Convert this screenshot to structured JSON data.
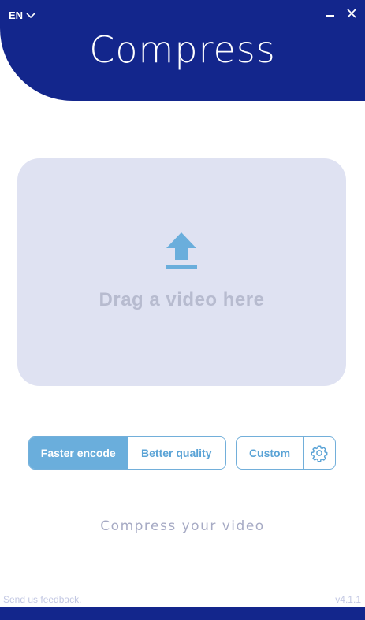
{
  "header": {
    "language": "EN",
    "title": "Compress",
    "background_color": "#13268c"
  },
  "window_controls": {
    "minimize_icon": "minimize-icon",
    "close_icon": "close-icon"
  },
  "dropzone": {
    "text": "Drag a video here",
    "icon": "upload-arrow-icon"
  },
  "modes": {
    "faster": "Faster encode",
    "better": "Better quality",
    "selected": "Faster encode",
    "custom": "Custom",
    "settings_icon": "gear-icon"
  },
  "action": {
    "label": "Compress your video"
  },
  "footer": {
    "feedback": "Send us feedback.",
    "version": "v4.1.1"
  },
  "colors": {
    "accent": "#6aaedc",
    "dropzone_bg": "#dfe2f2",
    "muted_text": "#b7bbcf"
  }
}
